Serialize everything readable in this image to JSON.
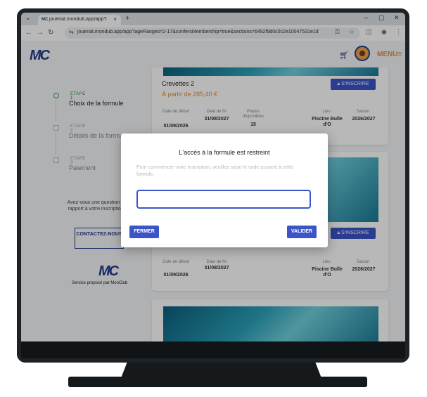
{
  "browser": {
    "tab_title": "jouenat.mondub.app/app?age",
    "tab_close": "×",
    "new_tab": "+",
    "url": "jouenat.mondub.app/app?ageRanges=2-17&confersMembership=true&sections=6492f9d0c0c2e10047531e1d"
  },
  "header": {
    "logo": "MC",
    "menu_label": "MENU≡"
  },
  "sidebar": {
    "steps": [
      {
        "label": "ETAPE 1",
        "name": "Choix de la formule"
      },
      {
        "label": "ETAPE 2",
        "name": "Détails de la formule"
      },
      {
        "label": "ETAPE 3",
        "name": "Paiement"
      }
    ],
    "question": "Avez-vous une question par rapport à votre inscription ?",
    "contact_label": "CONTACTEZ-NOUS",
    "logo": "MC",
    "service": "Service proposé par MonClub"
  },
  "cards": [
    {
      "title": "Crevettes 2",
      "price": "À partir de 285,40 €",
      "register_label": "S'INSCRIRE",
      "cols": {
        "start_label": "Date de début",
        "start": "01/09/2026",
        "end_label": "Date de fin",
        "end": "31/08/2027",
        "places_label": "Places disponibles",
        "places": "15",
        "place_label": "Lieu",
        "place": "Piscine Bulle d'O",
        "season_label": "Saison",
        "season": "2026/2027"
      }
    },
    {
      "register_label": "S'INSCRIRE",
      "cols": {
        "start_label": "Date de début",
        "start": "01/09/2026",
        "end_label": "Date de fin",
        "end": "31/08/2027",
        "place_label": "Lieu",
        "place": "Piscine Bulle d'O",
        "season_label": "Saison",
        "season": "2026/2027"
      }
    }
  ],
  "modal": {
    "title": "L'accès à la formule est restreint",
    "text": "Pour commencer votre inscription, veuillez saisir le code associé à cette formule.",
    "input_value": "",
    "cancel_label": "FERMER",
    "confirm_label": "VALIDER"
  },
  "colors": {
    "brand": "#233a8b",
    "accent": "#e38b3a",
    "button": "#3b54c7",
    "step_done": "#2f8b45"
  }
}
